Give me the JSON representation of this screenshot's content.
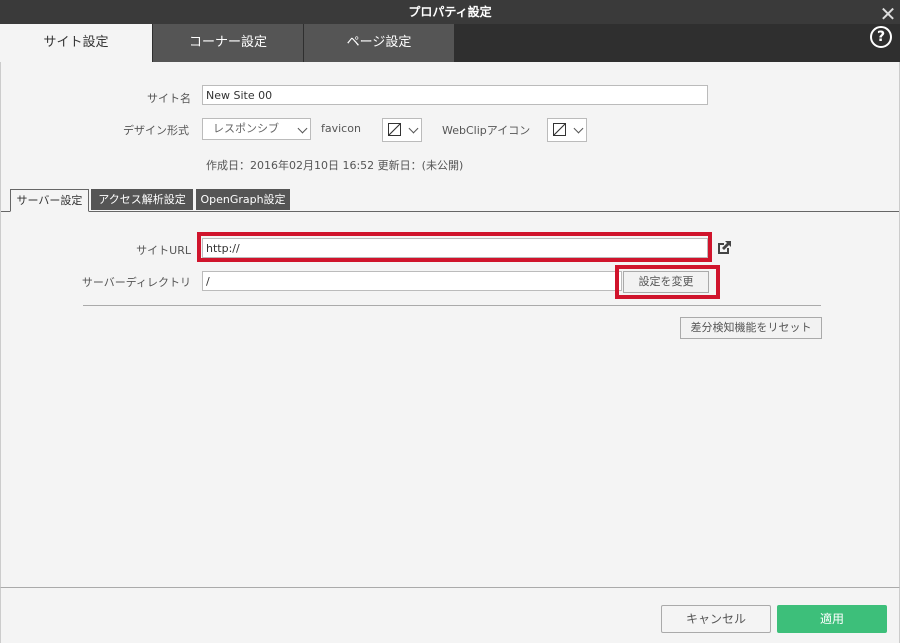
{
  "window": {
    "title": "プロパティ設定"
  },
  "main_tabs": [
    {
      "label": "サイト設定",
      "active": true
    },
    {
      "label": "コーナー設定",
      "active": false
    },
    {
      "label": "ページ設定",
      "active": false
    }
  ],
  "site": {
    "name_label": "サイト名",
    "name_value": "New Site 00",
    "design_label": "デザイン形式",
    "design_value": "レスポンシブ",
    "favicon_label": "favicon",
    "webclip_label": "WebClipアイコン",
    "dates": "作成日：2016年02月10日 16:52 更新日：(未公開)"
  },
  "sub_tabs": [
    {
      "label": "サーバー設定",
      "active": true
    },
    {
      "label": "アクセス解析設定",
      "active": false
    },
    {
      "label": "OpenGraph設定",
      "active": false
    }
  ],
  "server": {
    "url_label": "サイトURL",
    "url_value": "http://",
    "dir_label": "サーバーディレクトリ",
    "dir_value": "/",
    "change_button": "設定を変更",
    "reset_button": "差分検知機能をリセット"
  },
  "footer": {
    "cancel": "キャンセル",
    "apply": "適用"
  },
  "colors": {
    "accent_green": "#3dbf7a",
    "highlight_red": "#d0142c",
    "dark": "#3a3a3a"
  }
}
